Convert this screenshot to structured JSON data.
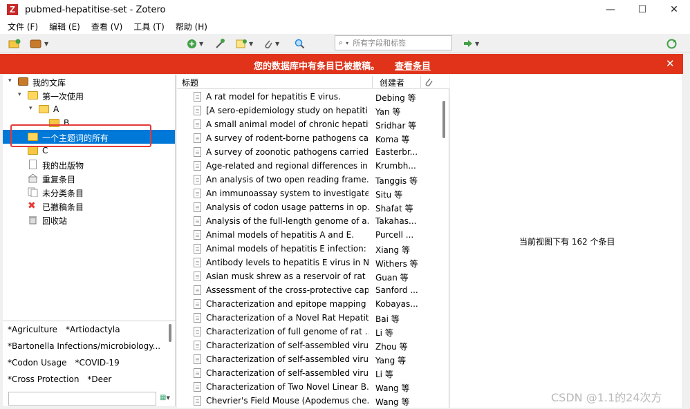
{
  "window": {
    "title": "pubmed-hepatitise-set - Zotero",
    "app_icon_letter": "Z",
    "minimize": "—",
    "maximize": "☐",
    "close": "✕"
  },
  "menu": [
    "文件 (F)",
    "编辑 (E)",
    "查看 (V)",
    "工具 (T)",
    "帮助 (H)"
  ],
  "search": {
    "placeholder": "所有字段和标签",
    "mag": "⌕",
    "dd": "▾"
  },
  "alert": {
    "message": "您的数据库中有条目已被撤稿。",
    "link": "查看条目",
    "close": "✕"
  },
  "tree": [
    {
      "label": "我的文库",
      "icon": "library-icon",
      "twisty": "▾"
    },
    {
      "label": "第一次使用",
      "icon": "folder-icon",
      "twisty": "▾"
    },
    {
      "label": "A",
      "icon": "folder-icon",
      "twisty": "▾"
    },
    {
      "label": "B",
      "icon": "folder-icon",
      "twisty": ""
    },
    {
      "label": "一个主题词的所有",
      "icon": "folder-icon",
      "twisty": "",
      "selected": true
    },
    {
      "label": "C",
      "icon": "folder-icon",
      "twisty": ""
    },
    {
      "label": "我的出版物",
      "icon": "publications-icon",
      "twisty": ""
    },
    {
      "label": "重复条目",
      "icon": "duplicates-icon",
      "twisty": ""
    },
    {
      "label": "未分类条目",
      "icon": "unfiled-icon",
      "twisty": ""
    },
    {
      "label": "已撤稿条目",
      "icon": "retracted-icon",
      "twisty": ""
    },
    {
      "label": "回收站",
      "icon": "trash-icon",
      "twisty": ""
    }
  ],
  "tags": [
    [
      "*Agriculture",
      "*Artiodactyla"
    ],
    [
      "*Bartonella Infections/microbiology..."
    ],
    [
      "*Codon Usage",
      "*COVID-19"
    ],
    [
      "*Cross Protection",
      "*Deer"
    ]
  ],
  "columns": {
    "title": "标题",
    "creator": "创建者"
  },
  "items": [
    {
      "title": "A rat model for hepatitis E virus.",
      "creator": "Debing 等"
    },
    {
      "title": "[A sero-epidemiology study on hepatiti...",
      "creator": "Yan 等"
    },
    {
      "title": "A small animal model of chronic hepatit...",
      "creator": "Sridhar 等"
    },
    {
      "title": "A survey of rodent-borne pathogens ca...",
      "creator": "Koma 等"
    },
    {
      "title": "A survey of zoonotic pathogens carried...",
      "creator": "Easterbr..."
    },
    {
      "title": "Age-related and regional differences in...",
      "creator": "Krumbh..."
    },
    {
      "title": "An analysis of two open reading frame...",
      "creator": "Tanggis 等"
    },
    {
      "title": "An immunoassay system to investigate...",
      "creator": "Situ 等"
    },
    {
      "title": "Analysis of codon usage patterns in op...",
      "creator": "Shafat 等"
    },
    {
      "title": "Analysis of the full-length genome of a...",
      "creator": "Takahas..."
    },
    {
      "title": "Animal models of hepatitis A and E.",
      "creator": "Purcell ..."
    },
    {
      "title": "Animal models of hepatitis E infection: ...",
      "creator": "Xiang 等"
    },
    {
      "title": "Antibody levels to hepatitis E virus in N...",
      "creator": "Withers 等"
    },
    {
      "title": "Asian musk shrew as a reservoir of rat ...",
      "creator": "Guan 等"
    },
    {
      "title": "Assessment of the cross-protective cap...",
      "creator": "Sanford ..."
    },
    {
      "title": "Characterization and epitope mapping ...",
      "creator": "Kobayas..."
    },
    {
      "title": "Characterization of a Novel Rat Hepatit...",
      "creator": "Bai 等"
    },
    {
      "title": "Characterization of full genome of rat ...",
      "creator": "Li 等"
    },
    {
      "title": "Characterization of self-assembled viru...",
      "creator": "Zhou 等"
    },
    {
      "title": "Characterization of self-assembled viru...",
      "creator": "Yang 等"
    },
    {
      "title": "Characterization of self-assembled viru...",
      "creator": "Li 等"
    },
    {
      "title": "Characterization of Two Novel Linear B...",
      "creator": "Wang 等"
    },
    {
      "title": "Chevrier's Field Mouse (Apodemus che...",
      "creator": "Wang 等"
    }
  ],
  "right_pane": {
    "message": "当前视图下有 162 个条目"
  },
  "watermark": "CSDN @1.1的24次方"
}
